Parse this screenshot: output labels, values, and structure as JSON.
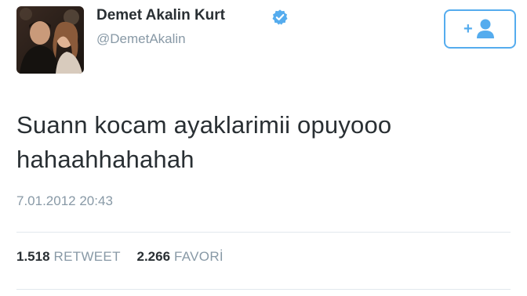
{
  "user": {
    "display_name": "Demet Akalin Kurt",
    "handle": "@DemetAkalin",
    "verified": true
  },
  "follow_button": {
    "icon": "follow-person-plus-icon",
    "label": "+"
  },
  "tweet": {
    "text_line1": "Suann kocam ayaklarimii opuyooo",
    "text_line2": "hahaahhahahah",
    "timestamp": "7.01.2012 20:43"
  },
  "stats": {
    "retweet_count": "1.518",
    "retweet_label": "RETWEET",
    "favorite_count": "2.266",
    "favorite_label": "FAVORİ"
  },
  "colors": {
    "accent": "#55acee",
    "text": "#292f33",
    "muted": "#8899a6",
    "divider": "#e1e8ed"
  }
}
